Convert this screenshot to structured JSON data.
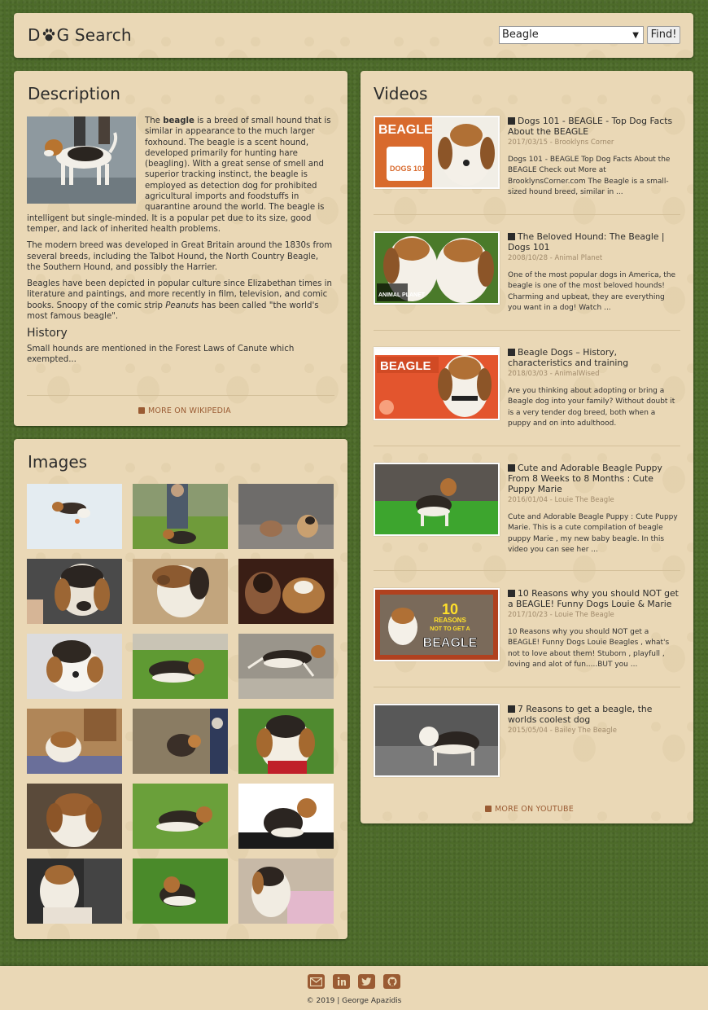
{
  "header": {
    "logo_prefix": "D",
    "logo_suffix": "G Search",
    "search_value": "Beagle",
    "find_label": "Find!"
  },
  "description": {
    "heading": "Description",
    "p1_pre": "The ",
    "p1_bold": "beagle",
    "p1_post": " is a breed of small hound that is similar in appearance to the much larger foxhound. The beagle is a scent hound, developed primarily for hunting hare (beagling). With a great sense of smell and superior tracking instinct, the beagle is employed as detection dog for prohibited agricultural imports and foodstuffs in quarantine around the world. The beagle is intelligent but single-minded. It is a popular pet due to its size, good temper, and lack of inherited health problems.",
    "p2": "The modern breed was developed in Great Britain around the 1830s from several breeds, including the Talbot Hound, the North Country Beagle, the Southern Hound, and possibly the Harrier.",
    "p3_pre": "Beagles have been depicted in popular culture since Elizabethan times in literature and paintings, and more recently in film, television, and comic books. Snoopy of the comic strip ",
    "p3_italic": "Peanuts",
    "p3_post": " has been called \"the world's most famous beagle\".",
    "history_heading": "History",
    "history_text": "Small hounds are mentioned in the Forest Laws of Canute which exempted...",
    "more_link": "MORE ON WIKIPEDIA"
  },
  "images": {
    "heading": "Images"
  },
  "videos": {
    "heading": "Videos",
    "items": [
      {
        "title": "Dogs 101 - BEAGLE - Top Dog Facts About the BEAGLE",
        "meta": "2017/03/15 - Brooklyns Corner",
        "desc": "Dogs 101 - BEAGLE Top Dog Facts About the BEAGLE Check out More at BrooklynsCorner.com The Beagle is a small-sized hound breed, similar in ...",
        "thumb_text": "BEAGLE",
        "thumb_badge": "DOGS 101"
      },
      {
        "title": "The Beloved Hound: The Beagle | Dogs 101",
        "meta": "2008/10/28 - Animal Planet",
        "desc": "One of the most popular dogs in America, the beagle is one of the most beloved hounds! Charming and upbeat, they are everything you want in a dog! Watch ...",
        "thumb_text": "ANIMAL PLANET"
      },
      {
        "title": "Beagle Dogs – History, characteristics and training",
        "meta": "2018/03/03 - AnimalWised",
        "desc": "Are you thinking about adopting or bring a Beagle dog into your family? Without doubt it is a very tender dog breed, both when a puppy and on into adulthood.",
        "thumb_text": "BEAGLE"
      },
      {
        "title": "Cute and Adorable Beagle Puppy From 8 Weeks to 8 Months : Cute Puppy Marie",
        "meta": "2016/01/04 - Louie The Beagle",
        "desc": "Cute and Adorable Beagle Puppy : Cute Puppy Marie. This is a cute compilation of beagle puppy Marie , my new baby beagle. In this video you can see her ..."
      },
      {
        "title": "10 Reasons why you should NOT get a BEAGLE! Funny Dogs Louie & Marie",
        "meta": "2017/10/23 - Louie The Beagle",
        "desc": "10 Reasons why you should NOT get a BEAGLE! Funny Dogs Louie Beagles , what's not to love about them! Stuborn , playfull , loving and alot of fun.....BUT you ...",
        "thumb_text_1": "10",
        "thumb_text_2": "REASONS",
        "thumb_text_3": "NOT TO GET A",
        "thumb_text_4": "BEAGLE"
      },
      {
        "title": "7 Reasons to get a beagle, the worlds coolest dog",
        "meta": "2015/05/04 - Bailey The Beagle",
        "desc": ""
      }
    ],
    "more_link": "MORE ON YOUTUBE"
  },
  "footer": {
    "copyright": "© 2019  |  George Apazidis"
  },
  "colors": {
    "accent": "#9a5b33",
    "panel": "#ead8b6",
    "background": "#4d6b2a"
  }
}
